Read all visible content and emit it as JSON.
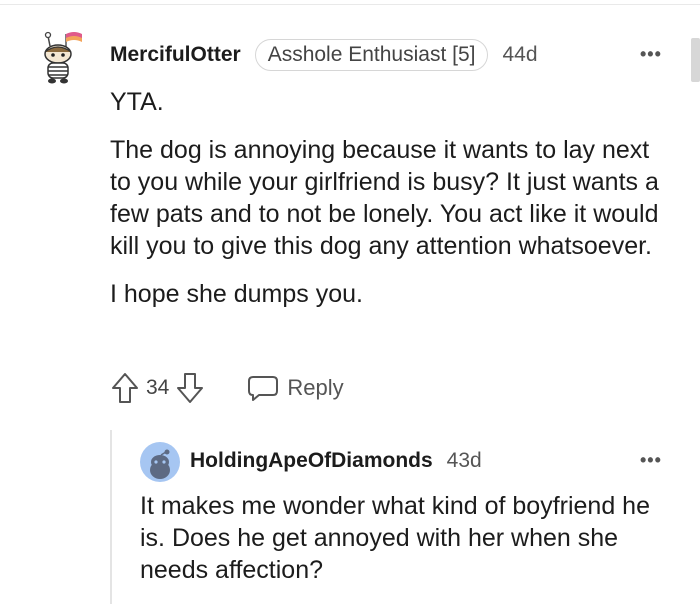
{
  "comment": {
    "username": "MercifulOtter",
    "flair": "Asshole Enthusiast [5]",
    "age": "44d",
    "more_label": "•••",
    "paragraphs": [
      "YTA.",
      "The dog is annoying because it wants to lay next to you while your girlfriend is busy? It just wants a few pats and to not be lonely. You act like it would kill you to give this dog any attention whatsoever.",
      "I hope she dumps you."
    ],
    "vote_count": "34",
    "reply_label": "Reply"
  },
  "reply": {
    "username": "HoldingApeOfDiamonds",
    "age": "43d",
    "more_label": "•••",
    "body": "It makes me wonder what kind of boyfriend he is. Does he get annoyed with her when she needs affection?"
  },
  "colors": {
    "avatar_blue": "#a6c6f2",
    "snoo_head": "#5d6a83",
    "flair_border": "#d6d6d6",
    "thread_line": "#e4e4e4"
  }
}
